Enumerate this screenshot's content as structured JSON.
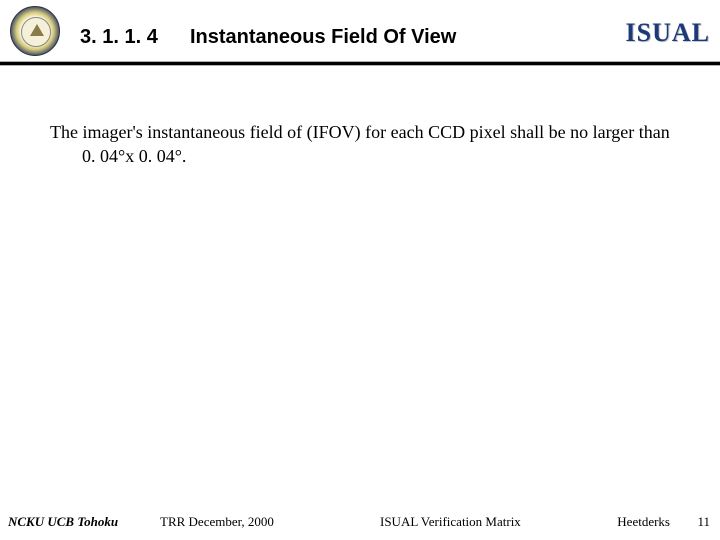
{
  "header": {
    "section_number": "3. 1. 1. 4",
    "title": "Instantaneous Field Of View",
    "logo_text": "ISUAL"
  },
  "body": {
    "paragraph": "The imager's instantaneous field of (IFOV) for each CCD pixel shall be no larger than 0. 04°x 0. 04°."
  },
  "footer": {
    "orgs": "NCKU   UCB   Tohoku",
    "doc_ref": "TRR   December,  2000",
    "doc_title": "ISUAL Verification Matrix",
    "author": "Heetderks",
    "page": "11"
  }
}
